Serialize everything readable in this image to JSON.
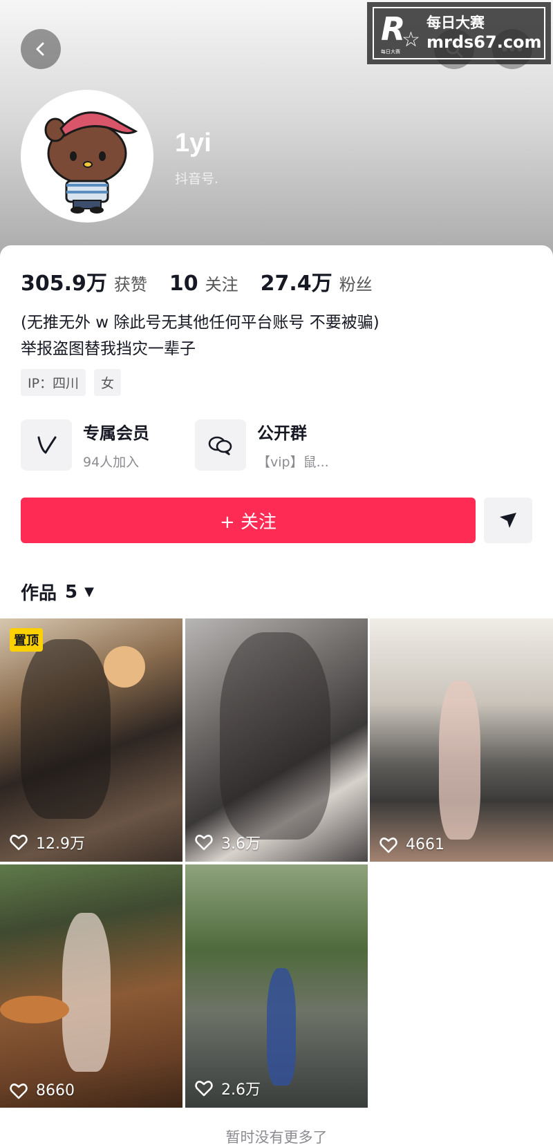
{
  "watermark": {
    "brand_cn": "每日大赛",
    "url": "mrds67.com",
    "mini": "每日大赛"
  },
  "profile": {
    "username": "1yi",
    "account_id_label": "抖音号."
  },
  "stats": [
    {
      "value": "305.9万",
      "label": "获赞"
    },
    {
      "value": "10",
      "label": "关注"
    },
    {
      "value": "27.4万",
      "label": "粉丝"
    }
  ],
  "bio": {
    "line1": "(无推无外 w 除此号无其他任何平台账号 不要被骗)",
    "line2": "举报盗图替我挡灾一辈子"
  },
  "tags": [
    "IP：四川",
    "女"
  ],
  "features": [
    {
      "title": "专属会员",
      "sub": "94人加入",
      "icon": "vip-icon"
    },
    {
      "title": "公开群",
      "sub": "【vip】鼠...",
      "icon": "group-chat-icon"
    }
  ],
  "follow_label": "+ 关注",
  "works": {
    "label": "作品",
    "count": "5"
  },
  "tiles": [
    {
      "likes": "12.9万",
      "pinned": "置顶"
    },
    {
      "likes": "3.6万"
    },
    {
      "likes": "4661"
    },
    {
      "likes": "8660"
    },
    {
      "likes": "2.6万"
    }
  ],
  "footer": "暂时没有更多了"
}
